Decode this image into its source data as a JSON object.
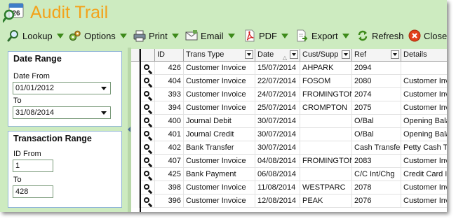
{
  "window": {
    "title": "Audit Trail",
    "calendar_day": "26"
  },
  "toolbar": {
    "lookup": "Lookup",
    "options": "Options",
    "print": "Print",
    "email": "Email",
    "pdf": "PDF",
    "export": "Export",
    "refresh": "Refresh",
    "close": "Close"
  },
  "date_range": {
    "heading": "Date Range",
    "from_label": "Date From",
    "from_value": "01/01/2012",
    "to_label": "To",
    "to_value": "31/08/2014"
  },
  "transaction_range": {
    "heading": "Transaction Range",
    "from_label": "ID From",
    "from_value": "1",
    "to_label": "To",
    "to_value": "428"
  },
  "grid": {
    "columns": [
      "ID",
      "Trans Type",
      "Date",
      "Cust/Supp",
      "Ref",
      "Details"
    ],
    "sorted_column": "Date",
    "rows": [
      {
        "id": "426",
        "type": "Customer Invoice",
        "date": "15/07/2014",
        "cust": "AHPARK",
        "ref": "2094",
        "details": ""
      },
      {
        "id": "404",
        "type": "Customer Invoice",
        "date": "22/07/2014",
        "cust": "FOSOM",
        "ref": "2080",
        "details": "Customer Inv"
      },
      {
        "id": "393",
        "type": "Customer Invoice",
        "date": "24/07/2014",
        "cust": "FROMINGTON",
        "ref": "2074",
        "details": "Customer Inv"
      },
      {
        "id": "394",
        "type": "Customer Invoice",
        "date": "25/07/2014",
        "cust": "CROMPTON",
        "ref": "2075",
        "details": "Customer Inv"
      },
      {
        "id": "400",
        "type": "Journal Debit",
        "date": "30/07/2014",
        "cust": "",
        "ref": "O/Bal",
        "details": "Opening Bala"
      },
      {
        "id": "401",
        "type": "Journal Credit",
        "date": "30/07/2014",
        "cust": "",
        "ref": "O/Bal",
        "details": "Opening Bala"
      },
      {
        "id": "402",
        "type": "Bank Transfer",
        "date": "30/07/2014",
        "cust": "",
        "ref": "Cash Transfe",
        "details": "Petty Cash T"
      },
      {
        "id": "407",
        "type": "Customer Invoice",
        "date": "04/08/2014",
        "cust": "FROMINGTON",
        "ref": "2083",
        "details": "Customer Inv"
      },
      {
        "id": "425",
        "type": "Bank Payment",
        "date": "06/08/2014",
        "cust": "",
        "ref": "C/C Int/Chg",
        "details": "Credit Card In"
      },
      {
        "id": "398",
        "type": "Customer Invoice",
        "date": "11/08/2014",
        "cust": "WESTPARC",
        "ref": "2078",
        "details": "Customer Inv"
      },
      {
        "id": "396",
        "type": "Customer Invoice",
        "date": "12/08/2014",
        "cust": "PEAK",
        "ref": "2076",
        "details": "Customer Inv"
      }
    ]
  },
  "colors": {
    "title": "#f3a21a",
    "background": "#cdebc0",
    "accent_arrow": "#3d8a1a",
    "group_border": "#8fb4d7"
  }
}
